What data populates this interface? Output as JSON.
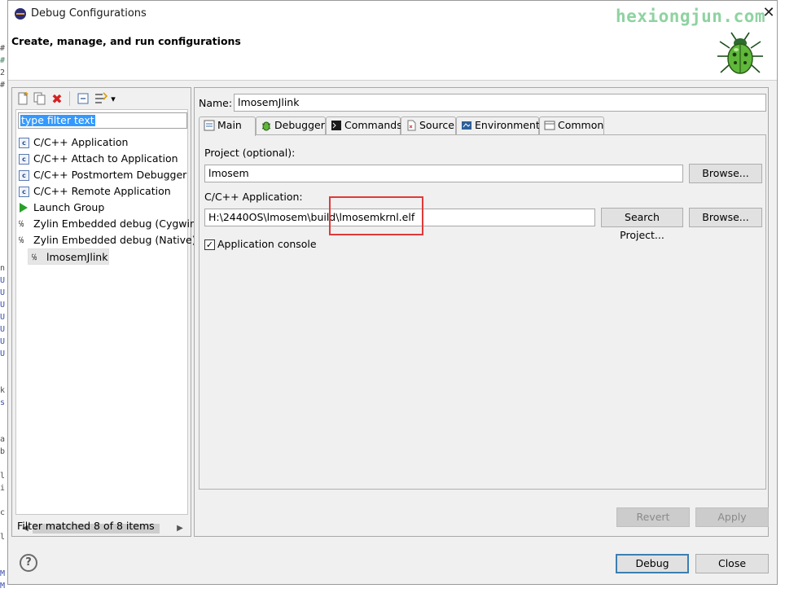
{
  "window": {
    "title": "Debug Configurations",
    "header_title": "Create, manage, and run configurations",
    "watermark": "hexiongjun.com",
    "close_glyph": "✕"
  },
  "toolbar": {
    "new_icon": "new-config-icon",
    "duplicate_icon": "duplicate-icon",
    "delete_icon": "delete-icon",
    "collapse_icon": "collapse-all-icon",
    "filter_icon": "filter-icon",
    "dropdown_glyph": "▾"
  },
  "filter": {
    "placeholder": "type filter text",
    "status": "Filter matched 8 of 8 items"
  },
  "tree": {
    "items": [
      {
        "label": "C/C++ Application",
        "icon": "c-app-icon"
      },
      {
        "label": "C/C++ Attach to Application",
        "icon": "c-attach-icon"
      },
      {
        "label": "C/C++ Postmortem Debugger",
        "icon": "c-postmortem-icon"
      },
      {
        "label": "C/C++ Remote Application",
        "icon": "c-remote-icon"
      },
      {
        "label": "Launch Group",
        "icon": "launch-group-icon"
      },
      {
        "label": "Zylin Embedded debug (Cygwin)",
        "icon": "zylin-icon"
      },
      {
        "label": "Zylin Embedded debug (Native)",
        "icon": "zylin-icon"
      },
      {
        "label": "lmosemJlink",
        "icon": "zylin-config-icon"
      }
    ]
  },
  "config": {
    "name_label": "Name:",
    "name_value": "lmosemJlink",
    "tabs": [
      {
        "label": "Main"
      },
      {
        "label": "Debugger"
      },
      {
        "label": "Commands"
      },
      {
        "label": "Source"
      },
      {
        "label": "Environment"
      },
      {
        "label": "Common"
      }
    ],
    "project_label": "Project (optional):",
    "project_value": "lmosem",
    "project_browse": "Browse...",
    "app_label": "C/C++ Application:",
    "app_value": "H:\\2440OS\\lmosem\\build\\lmosemkrnl.elf",
    "search_project": "Search Project...",
    "app_browse": "Browse...",
    "console_label": "Application console",
    "console_checked": true,
    "revert": "Revert",
    "apply": "Apply"
  },
  "footer": {
    "help": "?",
    "debug": "Debug",
    "close": "Close"
  },
  "background_snippets": [
    "#",
    "#",
    "2",
    "#",
    "n",
    "U",
    "U",
    "U",
    "U",
    "U",
    "U",
    "U",
    "k",
    "s",
    "a",
    "b",
    "l",
    "i",
    "c",
    "l",
    "M",
    "M"
  ]
}
